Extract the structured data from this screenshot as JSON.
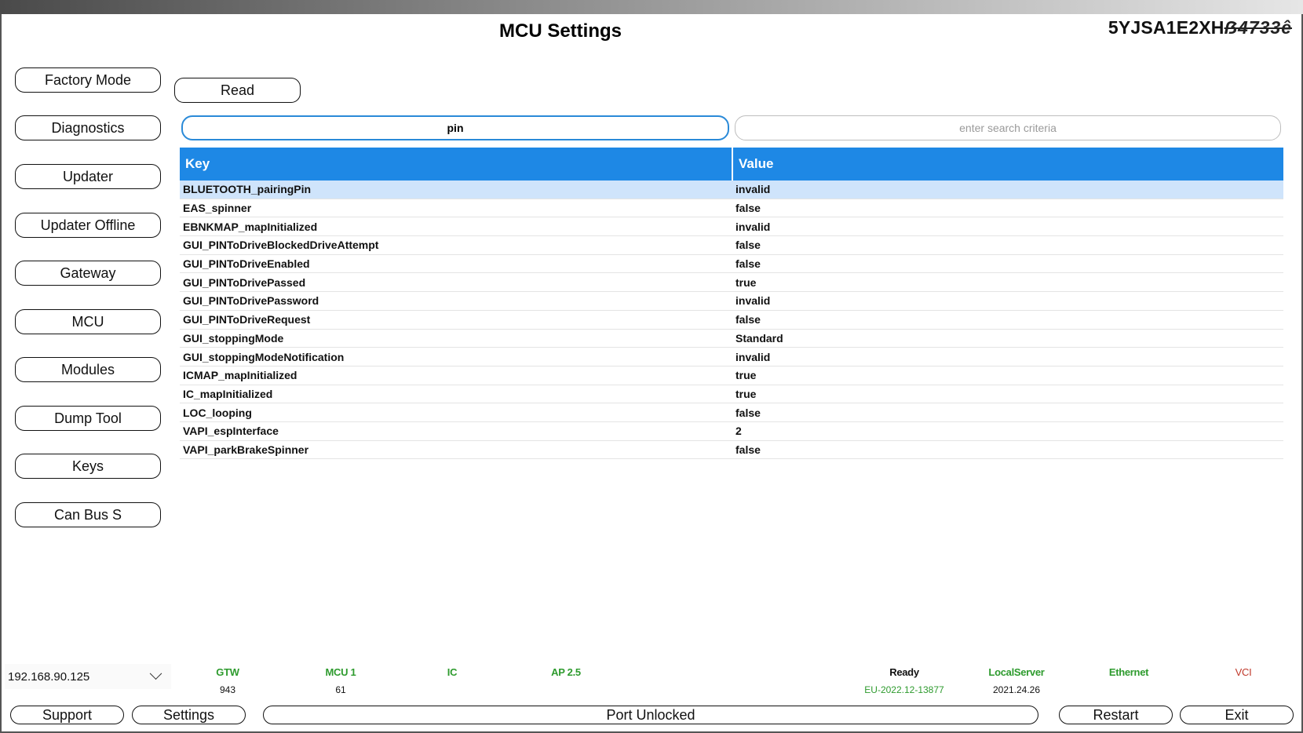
{
  "header": {
    "title": "MCU Settings",
    "vin": "5YJSA1E2XH",
    "vin_redacted": "ẞ4733ê"
  },
  "sidebar": {
    "items": [
      {
        "label": "Factory Mode"
      },
      {
        "label": "Diagnostics"
      },
      {
        "label": "Updater"
      },
      {
        "label": "Updater Offline"
      },
      {
        "label": "Gateway"
      },
      {
        "label": "MCU"
      },
      {
        "label": "Modules"
      },
      {
        "label": "Dump Tool"
      },
      {
        "label": "Keys"
      },
      {
        "label": "Can Bus S"
      }
    ]
  },
  "toolbar": {
    "read_label": "Read"
  },
  "search": {
    "key_value": "pin",
    "criteria_placeholder": "enter search criteria"
  },
  "table": {
    "headers": {
      "key": "Key",
      "value": "Value"
    },
    "rows": [
      {
        "key": "BLUETOOTH_pairingPin",
        "value": "invalid",
        "selected": true
      },
      {
        "key": "EAS_spinner",
        "value": "false"
      },
      {
        "key": "EBNKMAP_mapInitialized",
        "value": "invalid"
      },
      {
        "key": "GUI_PINToDriveBlockedDriveAttempt",
        "value": "false"
      },
      {
        "key": "GUI_PINToDriveEnabled",
        "value": "false"
      },
      {
        "key": "GUI_PINToDrivePassed",
        "value": "true"
      },
      {
        "key": "GUI_PINToDrivePassword",
        "value": "invalid"
      },
      {
        "key": "GUI_PINToDriveRequest",
        "value": "false"
      },
      {
        "key": "GUI_stoppingMode",
        "value": "Standard"
      },
      {
        "key": "GUI_stoppingModeNotification",
        "value": "invalid"
      },
      {
        "key": "ICMAP_mapInitialized",
        "value": "true"
      },
      {
        "key": "IC_mapInitialized",
        "value": "true"
      },
      {
        "key": "LOC_looping",
        "value": "false"
      },
      {
        "key": "VAPI_espInterface",
        "value": "2"
      },
      {
        "key": "VAPI_parkBrakeSpinner",
        "value": "false"
      }
    ]
  },
  "connection": {
    "ip": "192.168.90.125"
  },
  "status": {
    "gtw": {
      "label": "GTW",
      "value": "943"
    },
    "mcu": {
      "label": "MCU 1",
      "value": "61"
    },
    "ic": {
      "label": "IC",
      "value": ""
    },
    "ap": {
      "label": "AP 2.5",
      "value": ""
    },
    "ready": {
      "label": "Ready",
      "value": "EU-2022.12-13877"
    },
    "localserver": {
      "label": "LocalServer",
      "value": "2021.24.26"
    },
    "ethernet": {
      "label": "Ethernet",
      "value": ""
    },
    "vci": {
      "label": "VCI",
      "value": ""
    }
  },
  "colors": {
    "accent_blue": "#1e88e5",
    "selected_row": "#cfe4fb",
    "status_green": "#2e9b2e",
    "status_red": "#c0392b",
    "status_black": "#111111",
    "version_green": "#2e9b2e"
  },
  "bottom": {
    "support_label": "Support",
    "settings_label": "Settings",
    "port_label": "Port Unlocked",
    "restart_label": "Restart",
    "exit_label": "Exit"
  }
}
